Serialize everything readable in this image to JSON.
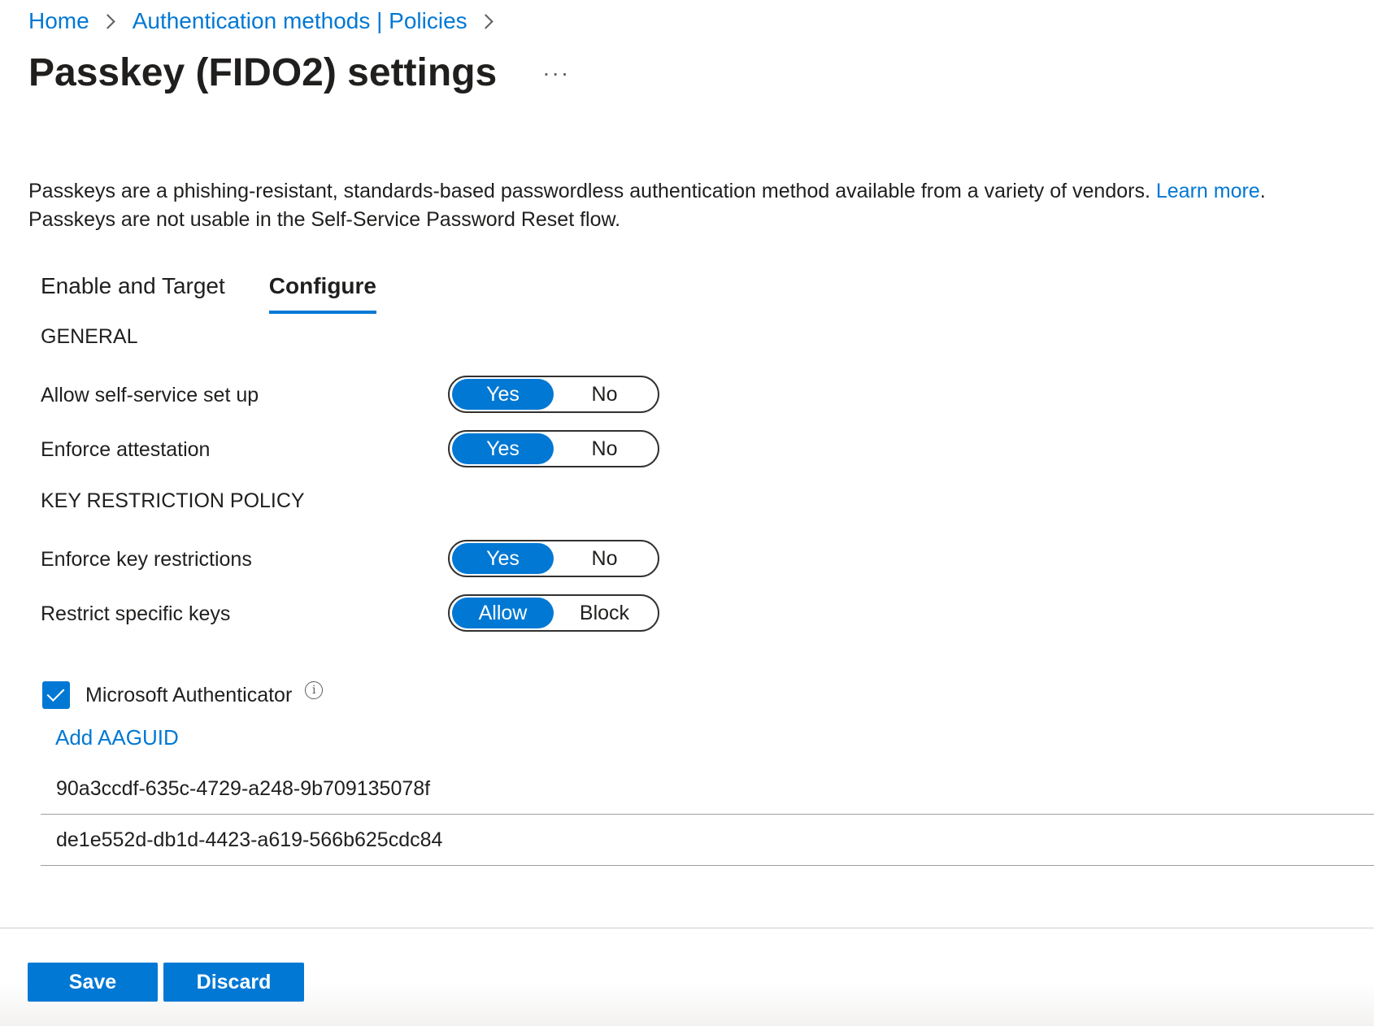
{
  "breadcrumb": {
    "home": "Home",
    "parent": "Authentication methods | Policies"
  },
  "header": {
    "title": "Passkey (FIDO2) settings",
    "more": "···"
  },
  "description": {
    "line1": "Passkeys are a phishing-resistant, standards-based passwordless authentication method available from a variety of vendors.",
    "learn_more": "Learn more",
    "line1_end": ".",
    "line2": "Passkeys are not usable in the Self-Service Password Reset flow."
  },
  "tabs": [
    {
      "label": "Enable and Target",
      "active": false
    },
    {
      "label": "Configure",
      "active": true
    }
  ],
  "general": {
    "header": "GENERAL",
    "settings": [
      {
        "label": "Allow self-service set up",
        "options": [
          "Yes",
          "No"
        ],
        "selected": "Yes"
      },
      {
        "label": "Enforce attestation",
        "options": [
          "Yes",
          "No"
        ],
        "selected": "Yes"
      }
    ]
  },
  "key_restriction": {
    "header": "KEY RESTRICTION POLICY",
    "settings": [
      {
        "label": "Enforce key restrictions",
        "options": [
          "Yes",
          "No"
        ],
        "selected": "Yes"
      },
      {
        "label": "Restrict specific keys",
        "options": [
          "Allow",
          "Block"
        ],
        "selected": "Allow"
      }
    ],
    "checkbox": {
      "label": "Microsoft Authenticator",
      "checked": true,
      "info_glyph": "i"
    },
    "add_link": "Add AAGUID",
    "aaguids": [
      "90a3ccdf-635c-4729-a248-9b709135078f",
      "de1e552d-db1d-4423-a619-566b625cdc84"
    ]
  },
  "footer": {
    "save_label": "Save",
    "discard_label": "Discard"
  },
  "colors": {
    "accent": "#0078d4",
    "text": "#201f1e",
    "divider": "#a19f9d"
  }
}
